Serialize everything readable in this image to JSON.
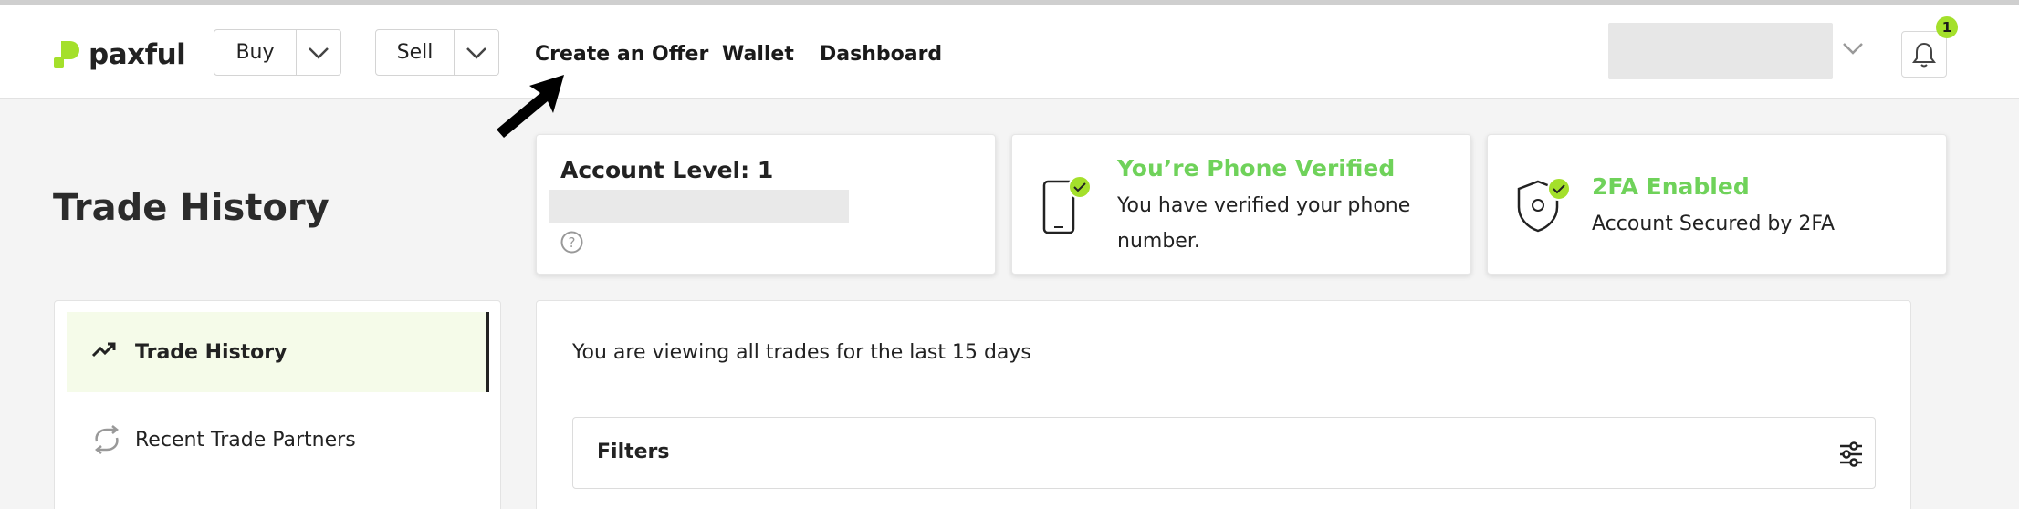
{
  "header": {
    "logo_text": "paxful",
    "buy_label": "Buy",
    "sell_label": "Sell",
    "nav": [
      "Create an Offer",
      "Wallet",
      "Dashboard"
    ],
    "notification_count": "1"
  },
  "page": {
    "title": "Trade History"
  },
  "cards": {
    "account_level": "Account Level: 1",
    "phone_title": "You’re Phone Verified",
    "phone_text": "You have verified your phone number.",
    "twofa_title": "2FA Enabled",
    "twofa_text": "Account Secured by 2FA"
  },
  "sidebar": {
    "items": [
      {
        "label": "Trade History",
        "icon": "trending-up-icon",
        "active": true
      },
      {
        "label": "Recent Trade Partners",
        "icon": "repeat-icon",
        "active": false
      }
    ]
  },
  "main": {
    "info": "You are viewing all trades for the last 15 days",
    "filters_label": "Filters"
  },
  "colors": {
    "brand_green": "#a4e02b",
    "verified_green": "#6fd25a",
    "active_bg": "#f5fbe9"
  }
}
